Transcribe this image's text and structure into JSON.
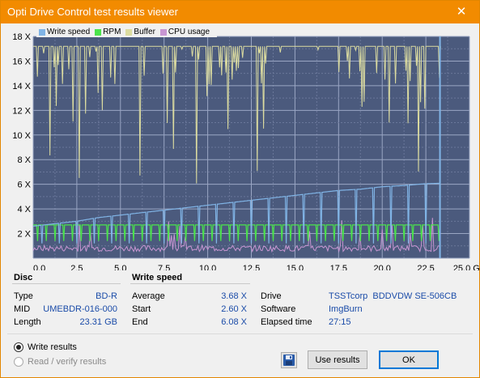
{
  "window": {
    "title": "Opti Drive Control test results viewer",
    "close_glyph": "✕"
  },
  "colors": {
    "write_speed": "#80b4e6",
    "rpm": "#4be44b",
    "buffer": "#dcdca0",
    "cpu_usage": "#c896d2",
    "plot_bg": "#4b5a7d",
    "grid": "#8090b0"
  },
  "legend": [
    {
      "label": "Write speed",
      "color": "#80b4e6"
    },
    {
      "label": "RPM",
      "color": "#4be44b"
    },
    {
      "label": "Buffer",
      "color": "#dcdca0"
    },
    {
      "label": "CPU usage",
      "color": "#c896d2"
    }
  ],
  "chart_data": {
    "type": "line",
    "x_unit": "GB",
    "xlim": [
      0,
      25
    ],
    "ylim": [
      0,
      18
    ],
    "x_ticks": [
      "0.0",
      "2.5",
      "5.0",
      "7.5",
      "10.0",
      "12.5",
      "15.0",
      "17.5",
      "20.0",
      "22.5",
      "25.0 GB"
    ],
    "y_ticks": [
      "2 X",
      "4 X",
      "6 X",
      "8 X",
      "10 X",
      "12 X",
      "14 X",
      "16 X",
      "18 X"
    ],
    "grid": true,
    "series": [
      {
        "name": "Write speed",
        "x": [
          0,
          1.25,
          2.5,
          3.75,
          5.0,
          6.25,
          7.5,
          8.75,
          10.0,
          11.25,
          12.5,
          13.75,
          15.0,
          16.25,
          17.5,
          18.75,
          20.0,
          21.25,
          22.5,
          23.31
        ],
        "values": [
          2.6,
          2.8,
          3.0,
          3.3,
          3.5,
          3.7,
          3.9,
          4.1,
          4.3,
          4.5,
          4.7,
          4.9,
          5.1,
          5.3,
          5.5,
          5.6,
          5.8,
          5.9,
          6.05,
          6.08
        ]
      },
      {
        "name": "RPM",
        "x": [
          0,
          23.31
        ],
        "values": [
          2.7,
          2.7
        ]
      },
      {
        "name": "Buffer",
        "x": [
          0,
          23.31
        ],
        "values": [
          17.2,
          17.2
        ]
      },
      {
        "name": "CPU usage",
        "x": [
          0,
          23.31
        ],
        "values": [
          0.8,
          0.8
        ]
      }
    ]
  },
  "disc": {
    "section_title": "Disc",
    "type_label": "Type",
    "type_value": "BD-R",
    "mid_label": "MID",
    "mid_value": "UMEBDR-016-000",
    "length_label": "Length",
    "length_value": "23.31 GB"
  },
  "write_speed": {
    "section_title": "Write speed",
    "average_label": "Average",
    "average_value": "3.68 X",
    "start_label": "Start",
    "start_value": "2.60 X",
    "end_label": "End",
    "end_value": "6.08 X"
  },
  "info": {
    "drive_label": "Drive",
    "drive_value": "TSSTcorp  BDDVDW SE-506CB",
    "software_label": "Software",
    "software_value": "ImgBurn",
    "elapsed_label": "Elapsed time",
    "elapsed_value": "27:15"
  },
  "options": {
    "write_results": "Write results",
    "read_verify_results": "Read / verify results"
  },
  "buttons": {
    "save_icon": "floppy-disk-icon",
    "use_results": "Use results",
    "ok": "OK"
  }
}
